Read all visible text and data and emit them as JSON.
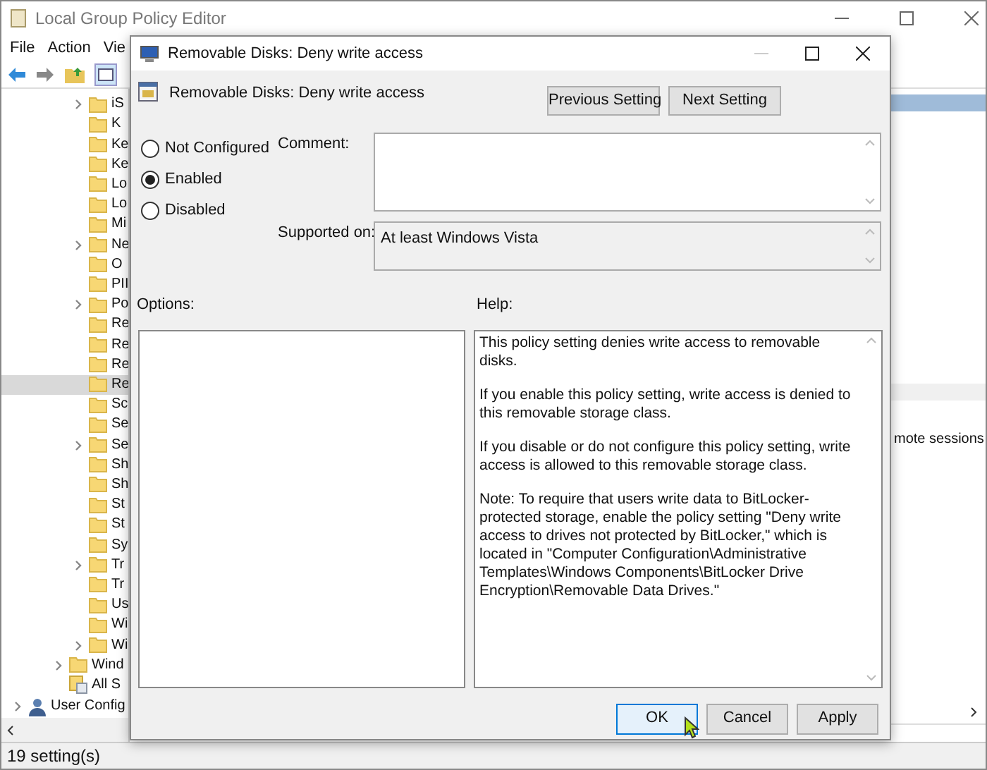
{
  "window": {
    "title": "Local Group Policy Editor"
  },
  "menu": [
    "File",
    "Action",
    "Vie"
  ],
  "tree": {
    "items": [
      {
        "label": "iS",
        "expandable": true,
        "selected": false
      },
      {
        "label": "K",
        "expandable": false,
        "selected": false
      },
      {
        "label": "Ke",
        "expandable": false,
        "selected": false
      },
      {
        "label": "Ke",
        "expandable": false,
        "selected": false
      },
      {
        "label": "Lo",
        "expandable": false,
        "selected": false
      },
      {
        "label": "Lo",
        "expandable": false,
        "selected": false
      },
      {
        "label": "Mi",
        "expandable": false,
        "selected": false
      },
      {
        "label": "Ne",
        "expandable": true,
        "selected": false
      },
      {
        "label": "O",
        "expandable": false,
        "selected": false
      },
      {
        "label": "PII",
        "expandable": false,
        "selected": false
      },
      {
        "label": "Po",
        "expandable": true,
        "selected": false
      },
      {
        "label": "Re",
        "expandable": false,
        "selected": false
      },
      {
        "label": "Re",
        "expandable": false,
        "selected": false
      },
      {
        "label": "Re",
        "expandable": false,
        "selected": false
      },
      {
        "label": "Re",
        "expandable": false,
        "selected": true
      },
      {
        "label": "Sc",
        "expandable": false,
        "selected": false
      },
      {
        "label": "Se",
        "expandable": false,
        "selected": false
      },
      {
        "label": "Se",
        "expandable": true,
        "selected": false
      },
      {
        "label": "Sh",
        "expandable": false,
        "selected": false
      },
      {
        "label": "Sh",
        "expandable": false,
        "selected": false
      },
      {
        "label": "St",
        "expandable": false,
        "selected": false
      },
      {
        "label": "St",
        "expandable": false,
        "selected": false
      },
      {
        "label": "Sy",
        "expandable": false,
        "selected": false
      },
      {
        "label": "Tr",
        "expandable": true,
        "selected": false
      },
      {
        "label": "Tr",
        "expandable": false,
        "selected": false
      },
      {
        "label": "Us",
        "expandable": false,
        "selected": false
      },
      {
        "label": "Wi",
        "expandable": false,
        "selected": false
      },
      {
        "label": "Wi",
        "expandable": true,
        "selected": false
      }
    ],
    "outer_items": [
      {
        "label": "Wind",
        "kind": "folder",
        "expandable": true
      },
      {
        "label": "All S",
        "kind": "settings",
        "expandable": false
      }
    ],
    "root_items": [
      {
        "label": "User Config",
        "kind": "user",
        "expandable": true
      }
    ]
  },
  "right_pane": {
    "row_text": "mote sessions"
  },
  "status_bar": "19 setting(s)",
  "dialog": {
    "title": "Removable Disks: Deny write access",
    "heading": "Removable Disks: Deny write access",
    "nav_buttons": [
      "Previous Setting",
      "Next Setting"
    ],
    "options": [
      {
        "label": "Not Configured",
        "selected": false
      },
      {
        "label": "Enabled",
        "selected": true
      },
      {
        "label": "Disabled",
        "selected": false
      }
    ],
    "comment_label": "Comment:",
    "supported_label": "Supported on:",
    "supported_value": "At least Windows Vista",
    "options_label": "Options:",
    "help_label": "Help:",
    "help": [
      "This policy setting denies write access to removable disks.",
      "If you enable this policy setting, write access is denied to this removable storage class.",
      "If you disable or do not configure this policy setting, write access is allowed to this removable storage class.",
      "Note: To require that users write data to BitLocker-protected storage, enable the policy setting \"Deny write access to drives not protected by BitLocker,\" which is located in \"Computer Configuration\\Administrative Templates\\Windows Components\\BitLocker Drive Encryption\\Removable Data Drives.\""
    ],
    "buttons": [
      {
        "label": "OK",
        "selected": true
      },
      {
        "label": "Cancel",
        "selected": false
      },
      {
        "label": "Apply",
        "selected": false
      }
    ]
  }
}
